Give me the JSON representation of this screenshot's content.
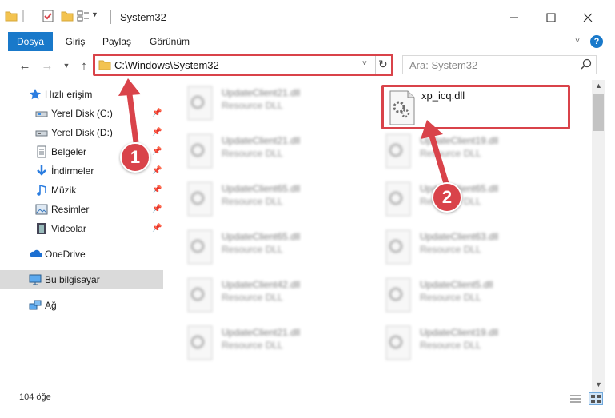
{
  "window": {
    "title": "System32"
  },
  "ribbon": {
    "tabs": [
      "Dosya",
      "Giriş",
      "Paylaş",
      "Görünüm"
    ]
  },
  "address": {
    "path": "C:\\Windows\\System32",
    "search_placeholder": "Ara: System32"
  },
  "sidebar": {
    "quick_access": "Hızlı erişim",
    "items": [
      {
        "label": "Yerel Disk (C:)",
        "icon": "drive-icon"
      },
      {
        "label": "Yerel Disk (D:)",
        "icon": "drive-icon"
      },
      {
        "label": "Belgeler",
        "icon": "documents-icon"
      },
      {
        "label": "İndirmeler",
        "icon": "download-icon"
      },
      {
        "label": "Müzik",
        "icon": "music-icon"
      },
      {
        "label": "Resimler",
        "icon": "pictures-icon"
      },
      {
        "label": "Videolar",
        "icon": "videos-icon"
      }
    ],
    "onedrive": "OneDrive",
    "this_pc": "Bu bilgisayar",
    "network": "Ağ"
  },
  "files": {
    "featured": {
      "name": "xp_icq.dll"
    },
    "left_column": [
      {
        "name": "UpdateClient21.dll",
        "type": "Resource DLL"
      },
      {
        "name": "UpdateClient21.dll",
        "type": "Resource DLL"
      },
      {
        "name": "UpdateClient65.dll",
        "type": "Resource DLL"
      },
      {
        "name": "UpdateClient65.dll",
        "type": "Resource DLL"
      },
      {
        "name": "UpdateClient42.dll",
        "type": "Resource DLL"
      },
      {
        "name": "UpdateClient21.dll",
        "type": "Resource DLL"
      }
    ],
    "right_column": [
      {
        "name": "UpdateClient19.dll",
        "type": "Resource DLL"
      },
      {
        "name": "UpdateClient65.dll",
        "type": "Resource DLL"
      },
      {
        "name": "UpdateClient63.dll",
        "type": "Resource DLL"
      },
      {
        "name": "UpdateClient5.dll",
        "type": "Resource DLL"
      },
      {
        "name": "UpdateClient19.dll",
        "type": "Resource DLL"
      }
    ]
  },
  "status": {
    "item_count": "104 öğe"
  },
  "annotations": {
    "marker1": "1",
    "marker2": "2"
  },
  "colors": {
    "accent": "#1979ca",
    "highlight": "#d9434a",
    "selected": "#dadada"
  }
}
